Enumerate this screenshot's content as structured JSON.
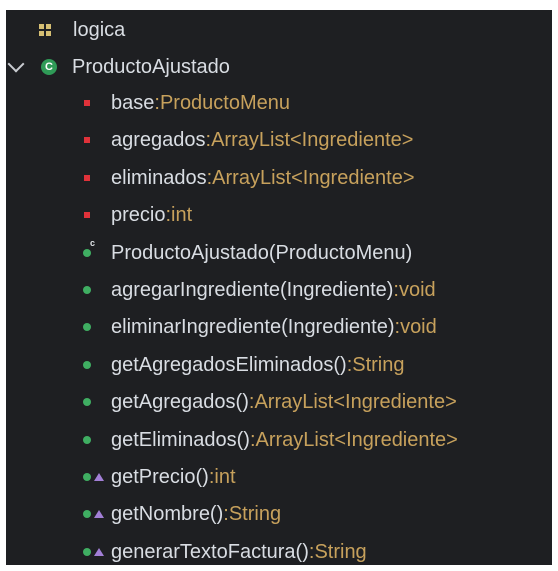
{
  "tree": {
    "package": {
      "name": "logica",
      "icon": "package-icon"
    },
    "class": {
      "name": "ProductoAjustado",
      "icon": "class-icon",
      "expanded": true
    },
    "members": [
      {
        "kind": "field",
        "icon": "private-field-icon",
        "name": "base",
        "sep": " : ",
        "type": "ProductoMenu"
      },
      {
        "kind": "field",
        "icon": "private-field-icon",
        "name": "agregados",
        "sep": " : ",
        "type": "ArrayList<Ingrediente>"
      },
      {
        "kind": "field",
        "icon": "private-field-icon",
        "name": "eliminados",
        "sep": " : ",
        "type": "ArrayList<Ingrediente>"
      },
      {
        "kind": "field",
        "icon": "private-field-icon",
        "name": "precio",
        "sep": " : ",
        "type": "int"
      },
      {
        "kind": "constructor",
        "icon": "constructor-icon",
        "name": "ProductoAjustado(ProductoMenu)",
        "sep": "",
        "type": ""
      },
      {
        "kind": "method",
        "icon": "public-method-icon",
        "name": "agregarIngrediente(Ingrediente)",
        "sep": " : ",
        "type": "void"
      },
      {
        "kind": "method",
        "icon": "public-method-icon",
        "name": "eliminarIngrediente(Ingrediente)",
        "sep": " : ",
        "type": "void"
      },
      {
        "kind": "method",
        "icon": "public-method-icon",
        "name": "getAgregadosEliminados()",
        "sep": " : ",
        "type": "String"
      },
      {
        "kind": "method",
        "icon": "public-method-icon",
        "name": "getAgregados()",
        "sep": " : ",
        "type": "ArrayList<Ingrediente>"
      },
      {
        "kind": "method",
        "icon": "public-method-icon",
        "name": "getEliminados()",
        "sep": " : ",
        "type": "ArrayList<Ingrediente>"
      },
      {
        "kind": "override",
        "icon": "override-method-icon",
        "name": "getPrecio()",
        "sep": " : ",
        "type": "int"
      },
      {
        "kind": "override",
        "icon": "override-method-icon",
        "name": "getNombre()",
        "sep": " : ",
        "type": "String"
      },
      {
        "kind": "override",
        "icon": "override-method-icon",
        "name": "generarTextoFactura()",
        "sep": " : ",
        "type": "String"
      }
    ]
  },
  "colors": {
    "background": "#1e1f22",
    "text": "#d9dde3",
    "type": "#c7a15c",
    "field": "#e0323a",
    "method": "#3fae62",
    "override": "#a27fd6",
    "package": "#d6bf73"
  }
}
